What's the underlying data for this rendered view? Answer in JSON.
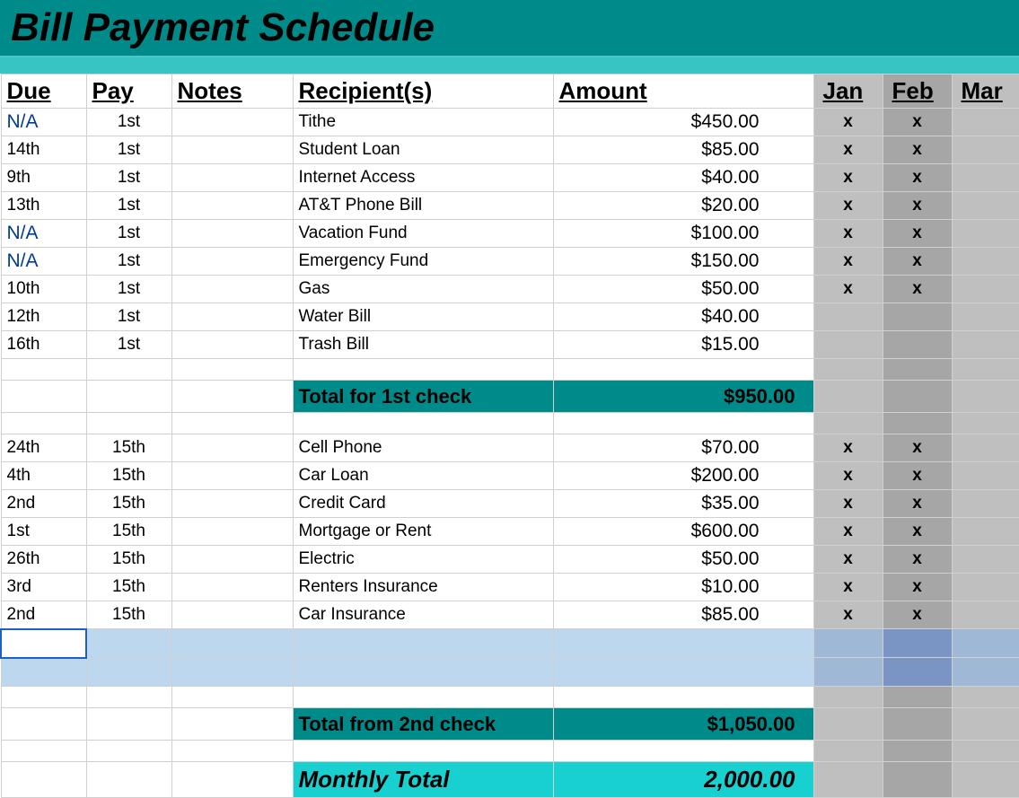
{
  "title": "Bill Payment Schedule",
  "headers": {
    "due": "Due",
    "pay": "Pay",
    "notes": "Notes",
    "recipient": "Recipient(s)",
    "amount": "Amount",
    "months": [
      "Jan",
      "Feb",
      "Mar"
    ]
  },
  "group1": [
    {
      "due": "N/A",
      "due_na": true,
      "pay": "1st",
      "recipient": "Tithe",
      "amount": "$450.00",
      "jan": "x",
      "feb": "x",
      "mar": ""
    },
    {
      "due": "14th",
      "due_na": false,
      "pay": "1st",
      "recipient": "Student Loan",
      "amount": "$85.00",
      "jan": "x",
      "feb": "x",
      "mar": ""
    },
    {
      "due": "9th",
      "due_na": false,
      "pay": "1st",
      "recipient": "Internet Access",
      "amount": "$40.00",
      "jan": "x",
      "feb": "x",
      "mar": ""
    },
    {
      "due": "13th",
      "due_na": false,
      "pay": "1st",
      "recipient": "AT&T Phone Bill",
      "amount": "$20.00",
      "jan": "x",
      "feb": "x",
      "mar": ""
    },
    {
      "due": "N/A",
      "due_na": true,
      "pay": "1st",
      "recipient": "Vacation Fund",
      "amount": "$100.00",
      "jan": "x",
      "feb": "x",
      "mar": ""
    },
    {
      "due": "N/A",
      "due_na": true,
      "pay": "1st",
      "recipient": "Emergency Fund",
      "amount": "$150.00",
      "jan": "x",
      "feb": "x",
      "mar": ""
    },
    {
      "due": "10th",
      "due_na": false,
      "pay": "1st",
      "recipient": "Gas",
      "amount": "$50.00",
      "jan": "x",
      "feb": "x",
      "mar": ""
    },
    {
      "due": "12th",
      "due_na": false,
      "pay": "1st",
      "recipient": "Water Bill",
      "amount": "$40.00",
      "jan": "",
      "feb": "",
      "mar": ""
    },
    {
      "due": "16th",
      "due_na": false,
      "pay": "1st",
      "recipient": "Trash Bill",
      "amount": "$15.00",
      "jan": "",
      "feb": "",
      "mar": ""
    }
  ],
  "subtotal1": {
    "label": "Total for 1st check",
    "amount": "$950.00"
  },
  "group2": [
    {
      "due": "24th",
      "pay": "15th",
      "recipient": "Cell Phone",
      "amount": "$70.00",
      "jan": "x",
      "feb": "x",
      "mar": ""
    },
    {
      "due": "4th",
      "pay": "15th",
      "recipient": "Car Loan",
      "amount": "$200.00",
      "jan": "x",
      "feb": "x",
      "mar": ""
    },
    {
      "due": "2nd",
      "pay": "15th",
      "recipient": "Credit Card",
      "amount": "$35.00",
      "jan": "x",
      "feb": "x",
      "mar": ""
    },
    {
      "due": "1st",
      "pay": "15th",
      "recipient": "Mortgage or Rent",
      "amount": "$600.00",
      "jan": "x",
      "feb": "x",
      "mar": ""
    },
    {
      "due": "26th",
      "pay": "15th",
      "recipient": "Electric",
      "amount": "$50.00",
      "jan": "x",
      "feb": "x",
      "mar": ""
    },
    {
      "due": "3rd",
      "pay": "15th",
      "recipient": "Renters Insurance",
      "amount": "$10.00",
      "jan": "x",
      "feb": "x",
      "mar": ""
    },
    {
      "due": "2nd",
      "pay": "15th",
      "recipient": "Car Insurance",
      "amount": "$85.00",
      "jan": "x",
      "feb": "x",
      "mar": ""
    }
  ],
  "subtotal2": {
    "label": "Total from 2nd check",
    "amount": "$1,050.00"
  },
  "monthly": {
    "label": "Monthly Total",
    "amount": "2,000.00"
  }
}
